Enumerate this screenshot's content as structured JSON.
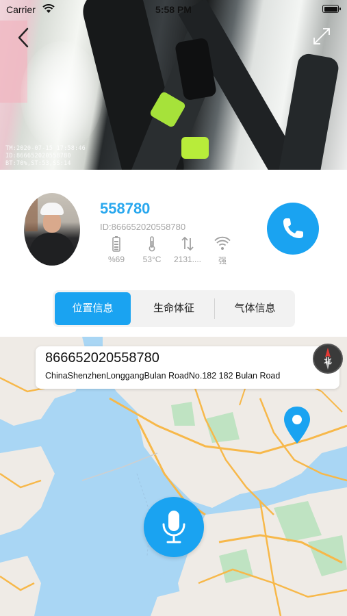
{
  "status_bar": {
    "carrier": "Carrier",
    "time": "5:58 PM"
  },
  "camera": {
    "osd_lines": [
      "TM:2020-07-15 17:58:46",
      "ID:866652020558780",
      "BT:70%,ST:53,SS:14"
    ]
  },
  "device": {
    "name": "558780",
    "id_label": "ID:866652020558780",
    "stats": {
      "battery": "%69",
      "temperature": "53°C",
      "traffic": "2131....",
      "signal": "强"
    }
  },
  "tabs": [
    {
      "label": "位置信息",
      "active": true
    },
    {
      "label": "生命体征",
      "active": false
    },
    {
      "label": "气体信息",
      "active": false
    }
  ],
  "map": {
    "callout_id": "866652020558780",
    "callout_address": "ChinaShenzhenLonggangBulan RoadNo.182 182 Bulan Road",
    "compass_label": "北"
  },
  "colors": {
    "accent": "#1aa3f1",
    "name_blue": "#2aa8ee",
    "muted": "#a0a0a0"
  }
}
